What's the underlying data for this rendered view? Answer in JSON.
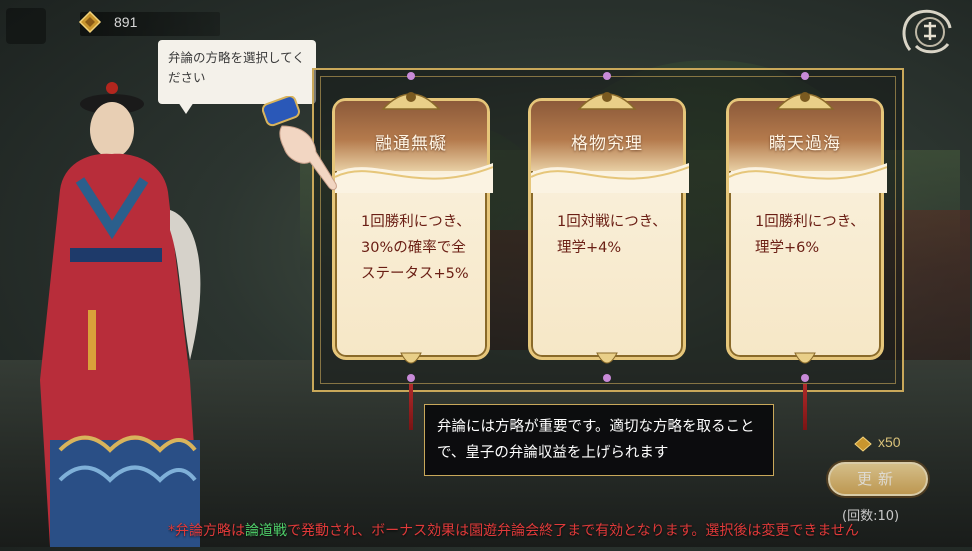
{
  "header": {
    "currency_value": "891",
    "currency_icon": "gem-icon"
  },
  "speech": {
    "text": "弁論の方略を選択してください"
  },
  "cards": [
    {
      "title": "融通無礙",
      "text": "1回勝利につき、30%の確率で全ステータス+5%"
    },
    {
      "title": "格物究理",
      "text": "1回対戦につき、理学+4%"
    },
    {
      "title": "瞞天過海",
      "text": "1回勝利につき、理学+6%"
    }
  ],
  "info": {
    "text": "弁論には方略が重要です。適切な方略を取ることで、皇子の弁論収益を上げられます"
  },
  "refresh": {
    "cost": "x50",
    "label": "更新",
    "count": "(回数:10)"
  },
  "footer": {
    "prefix": "*弁論方略は",
    "highlight": "論道戦",
    "suffix": "で発動され、ボーナス効果は園遊弁論会終了まで有効となります。選択後は変更できません"
  },
  "colors": {
    "gold": "#c9a85a",
    "card_text": "#6a1e14",
    "footer_red": "#e03a3a",
    "highlight_green": "#4fd06a"
  }
}
